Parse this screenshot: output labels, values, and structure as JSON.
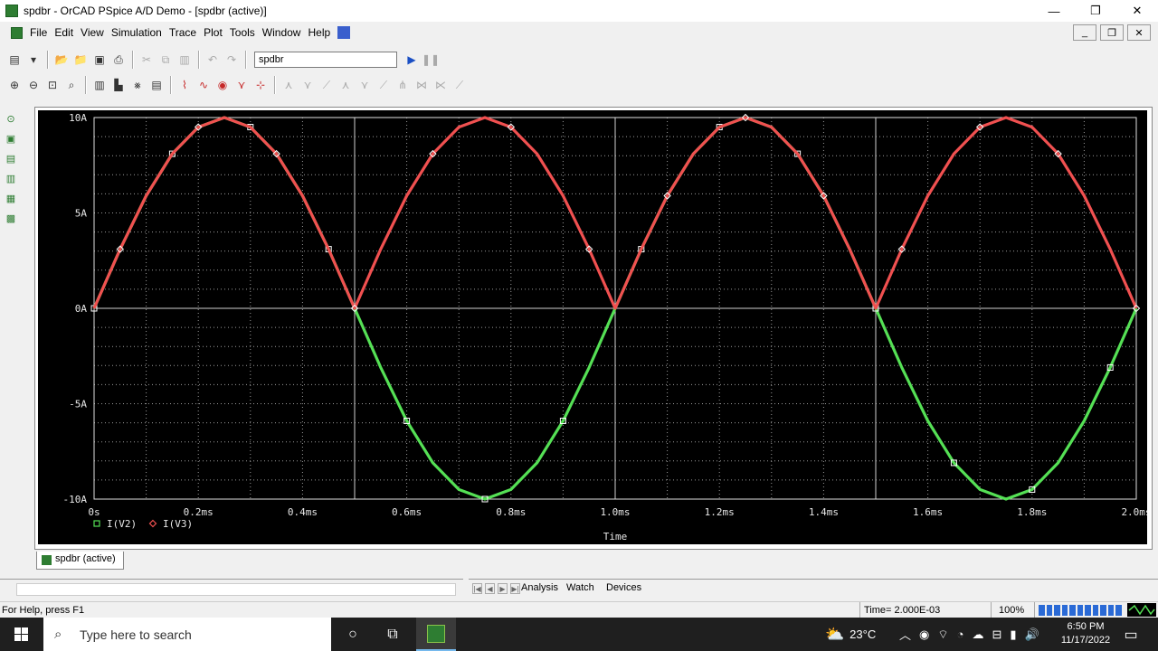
{
  "window": {
    "title": "spdbr - OrCAD PSpice A/D Demo  - [spdbr (active)]",
    "minimize": "—",
    "maximize": "❐",
    "close": "✕"
  },
  "menubar": {
    "items": [
      "File",
      "Edit",
      "View",
      "Simulation",
      "Trace",
      "Plot",
      "Tools",
      "Window",
      "Help"
    ]
  },
  "toolbar": {
    "profile_value": "spdbr"
  },
  "chart_data": {
    "type": "line",
    "x_range": [
      0,
      2.0
    ],
    "x_unit": "ms",
    "xlabel": "Time",
    "y_range": [
      -10,
      10
    ],
    "x_ticks": [
      "0s",
      "0.2ms",
      "0.4ms",
      "0.6ms",
      "0.8ms",
      "1.0ms",
      "1.2ms",
      "1.4ms",
      "1.6ms",
      "1.8ms",
      "2.0ms"
    ],
    "y_ticks": [
      "10A",
      "5A",
      "0A",
      "-5A",
      "-10A"
    ],
    "grid": true,
    "background": "#000000",
    "series": [
      {
        "name": "I(V2)",
        "color": "#55e055",
        "marker": "square",
        "x": [
          0,
          0.05,
          0.1,
          0.15,
          0.2,
          0.25,
          0.3,
          0.35,
          0.4,
          0.45,
          0.5,
          0.55,
          0.6,
          0.65,
          0.7,
          0.75,
          0.8,
          0.85,
          0.9,
          0.95,
          1.0,
          1.05,
          1.1,
          1.15,
          1.2,
          1.25,
          1.3,
          1.35,
          1.4,
          1.45,
          1.5,
          1.55,
          1.6,
          1.65,
          1.7,
          1.75,
          1.8,
          1.85,
          1.9,
          1.95,
          2.0
        ],
        "y": [
          0,
          3.1,
          5.9,
          8.1,
          9.5,
          10.0,
          9.5,
          8.1,
          5.9,
          3.1,
          0,
          -3.1,
          -5.9,
          -8.1,
          -9.5,
          -10.0,
          -9.5,
          -8.1,
          -5.9,
          -3.1,
          0,
          3.1,
          5.9,
          8.1,
          9.5,
          10.0,
          9.5,
          8.1,
          5.9,
          3.1,
          0,
          -3.1,
          -5.9,
          -8.1,
          -9.5,
          -10.0,
          -9.5,
          -8.1,
          -5.9,
          -3.1,
          0
        ]
      },
      {
        "name": "I(V3)",
        "color": "#f05050",
        "marker": "diamond",
        "x": [
          0,
          0.05,
          0.1,
          0.15,
          0.2,
          0.25,
          0.3,
          0.35,
          0.4,
          0.45,
          0.5,
          0.55,
          0.6,
          0.65,
          0.7,
          0.75,
          0.8,
          0.85,
          0.9,
          0.95,
          1.0,
          1.05,
          1.1,
          1.15,
          1.2,
          1.25,
          1.3,
          1.35,
          1.4,
          1.45,
          1.5,
          1.55,
          1.6,
          1.65,
          1.7,
          1.75,
          1.8,
          1.85,
          1.9,
          1.95,
          2.0
        ],
        "y": [
          0,
          3.1,
          5.9,
          8.1,
          9.5,
          10.0,
          9.5,
          8.1,
          5.9,
          3.1,
          0,
          3.1,
          5.9,
          8.1,
          9.5,
          10.0,
          9.5,
          8.1,
          5.9,
          3.1,
          0,
          3.1,
          5.9,
          8.1,
          9.5,
          10.0,
          9.5,
          8.1,
          5.9,
          3.1,
          0,
          3.1,
          5.9,
          8.1,
          9.5,
          10.0,
          9.5,
          8.1,
          5.9,
          3.1,
          0
        ]
      }
    ]
  },
  "plot_tab": {
    "label": "spdbr (active)"
  },
  "output_tabs": [
    "Analysis",
    "Watch",
    "Devices"
  ],
  "statusbar": {
    "help": "For Help, press F1",
    "time": "Time= 2.000E-03",
    "percent": "100%"
  },
  "taskbar": {
    "search_placeholder": "Type here to search",
    "weather": "23°C",
    "time": "6:50 PM",
    "date": "11/17/2022"
  }
}
